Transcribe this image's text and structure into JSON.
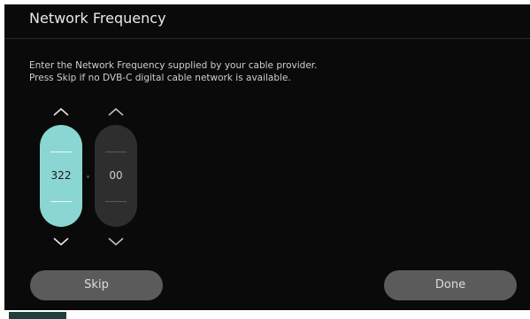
{
  "window": {
    "title": "Network Frequency"
  },
  "instructions": {
    "line1": "Enter the Network Frequency supplied by your cable provider.",
    "line2": "Press Skip if no DVB-C digital cable network is available."
  },
  "frequency": {
    "integer_part": "322",
    "decimal_part": "00",
    "active_field": "integer_part"
  },
  "buttons": {
    "skip_label": "Skip",
    "done_label": "Done"
  },
  "colors": {
    "panel_bg": "#0a0a0a",
    "active_wheel": "#8ad6d3",
    "inactive_wheel": "#2e2e2e",
    "button_bg": "#5b5b5b"
  },
  "icons": {
    "up": "chevron-up-icon",
    "down": "chevron-down-icon"
  }
}
